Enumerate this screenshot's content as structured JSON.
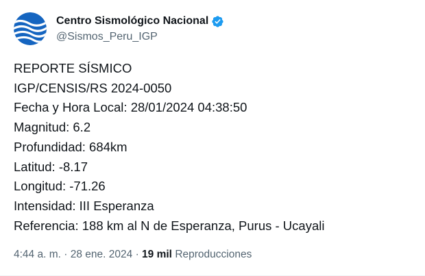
{
  "author": {
    "display_name": "Centro Sismológico Nacional",
    "handle": "@Sismos_Peru_IGP",
    "verified": true,
    "avatar_icon": "igp-logo-icon",
    "verified_icon": "verified-badge-icon",
    "brand_color": "#1565c0",
    "verified_color": "#1d9bf0"
  },
  "post": {
    "lines": [
      "REPORTE SÍSMICO",
      "IGP/CENSIS/RS 2024-0050",
      "Fecha y Hora Local: 28/01/2024 04:38:50",
      "Magnitud: 6.2",
      "Profundidad: 684km",
      "Latitud: -8.17",
      "Longitud: -71.26",
      "Intensidad: III Esperanza",
      "Referencia: 188 km al N de Esperanza, Purus - Ucayali"
    ]
  },
  "meta": {
    "time": "4:44 a. m.",
    "separator": "·",
    "date": "28 ene. 2024",
    "views_count": "19 mil",
    "views_label": "Reproducciones"
  }
}
